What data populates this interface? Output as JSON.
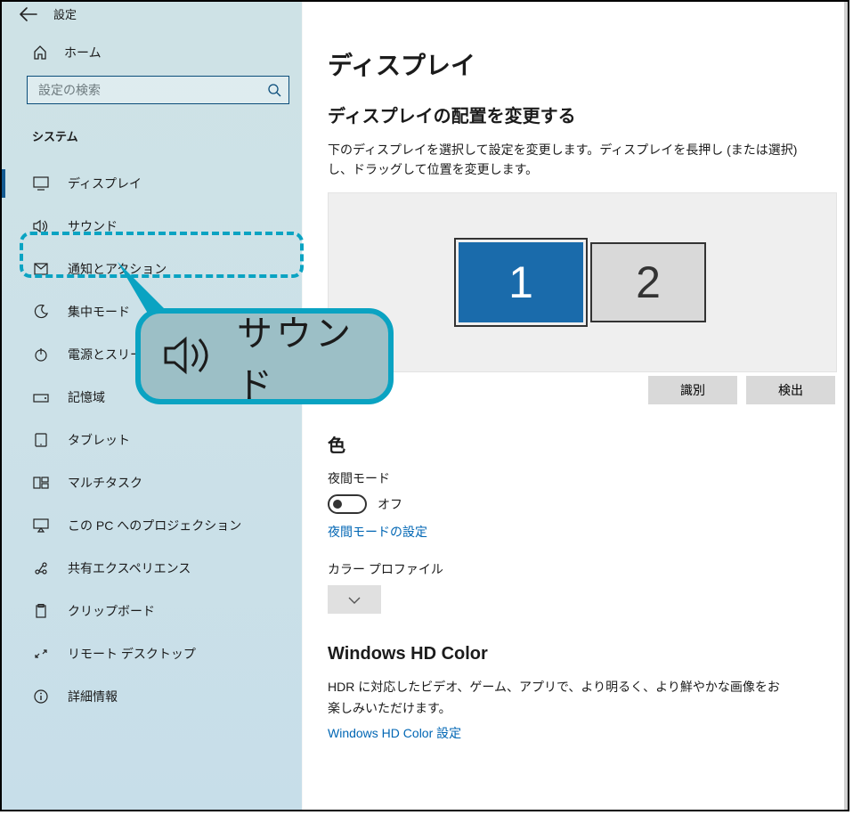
{
  "header": {
    "title": "設定"
  },
  "sidebar": {
    "home": "ホーム",
    "search_placeholder": "設定の検索",
    "category": "システム",
    "items": [
      {
        "label": "ディスプレイ",
        "icon": "monitor-icon"
      },
      {
        "label": "サウンド",
        "icon": "speaker-icon"
      },
      {
        "label": "通知とアクション",
        "icon": "notification-icon"
      },
      {
        "label": "集中モード",
        "icon": "moon-icon"
      },
      {
        "label": "電源とスリープ",
        "icon": "power-icon"
      },
      {
        "label": "記憶域",
        "icon": "storage-icon"
      },
      {
        "label": "タブレット",
        "icon": "tablet-icon"
      },
      {
        "label": "マルチタスク",
        "icon": "multitask-icon"
      },
      {
        "label": "この PC へのプロジェクション",
        "icon": "projection-icon"
      },
      {
        "label": "共有エクスペリエンス",
        "icon": "share-icon"
      },
      {
        "label": "クリップボード",
        "icon": "clipboard-icon"
      },
      {
        "label": "リモート デスクトップ",
        "icon": "remote-icon"
      },
      {
        "label": "詳細情報",
        "icon": "info-icon"
      }
    ]
  },
  "callout": {
    "label": "サウンド"
  },
  "main": {
    "title": "ディスプレイ",
    "arrange_heading": "ディスプレイの配置を変更する",
    "arrange_desc": "下のディスプレイを選択して設定を変更します。ディスプレイを長押し (または選択) し、ドラッグして位置を変更します。",
    "monitors": {
      "primary": "1",
      "secondary": "2"
    },
    "identify_label": "識別",
    "detect_label": "検出",
    "color_heading": "色",
    "night_mode_label": "夜間モード",
    "toggle_state": "オフ",
    "night_mode_link": "夜間モードの設定",
    "color_profile_label": "カラー プロファイル",
    "hd_heading": "Windows HD Color",
    "hd_desc": "HDR に対応したビデオ、ゲーム、アプリで、より明るく、より鮮やかな画像をお楽しみいただけます。",
    "hd_link": "Windows HD Color 設定"
  }
}
